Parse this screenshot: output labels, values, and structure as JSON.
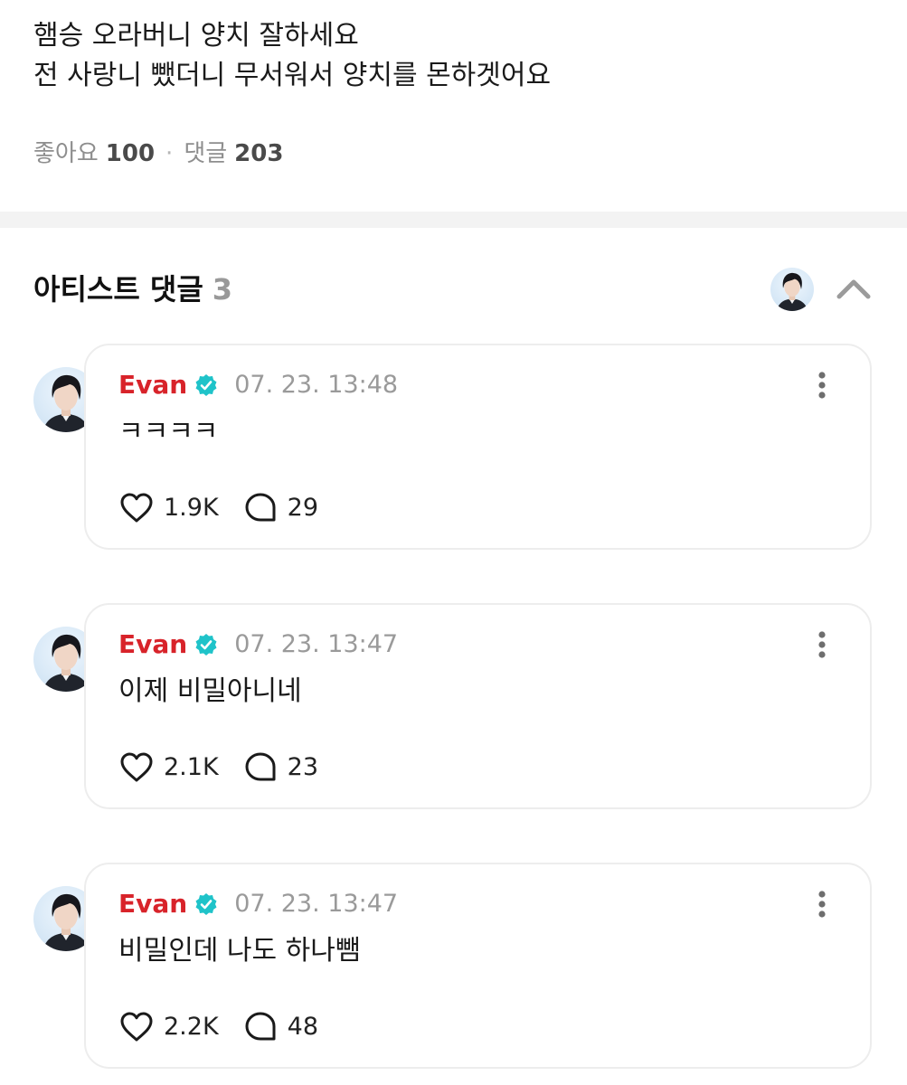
{
  "post": {
    "lines": [
      "햄승 오라버니 양치 잘하세요",
      "전 사랑니 뺐더니 무서워서 양치를 몬하겟어요"
    ],
    "likes_label": "좋아요",
    "likes_count": "100",
    "separator": "·",
    "comments_label": "댓글",
    "comments_count": "203"
  },
  "artist_comments": {
    "title": "아티스트 댓글",
    "count": "3",
    "header_avatar_icon": "artist-avatar",
    "collapse_icon": "chevron-up-icon",
    "items": [
      {
        "author": "Evan",
        "timestamp": "07. 23. 13:48",
        "text": "ㅋㅋㅋㅋ",
        "likes": "1.9K",
        "replies": "29"
      },
      {
        "author": "Evan",
        "timestamp": "07. 23. 13:47",
        "text": "이제 비밀아니네",
        "likes": "2.1K",
        "replies": "23"
      },
      {
        "author": "Evan",
        "timestamp": "07. 23. 13:47",
        "text": "비밀인데 나도 하나뺌",
        "likes": "2.2K",
        "replies": "48"
      }
    ]
  },
  "colors": {
    "author": "#d8232a",
    "verified": "#1fc3c9",
    "muted": "#9a9a9a",
    "divider": "#f3f3f3"
  },
  "icons": [
    "verified-badge-icon",
    "more-vertical-icon",
    "heart-icon",
    "reply-bubble-icon",
    "chevron-up-icon"
  ]
}
